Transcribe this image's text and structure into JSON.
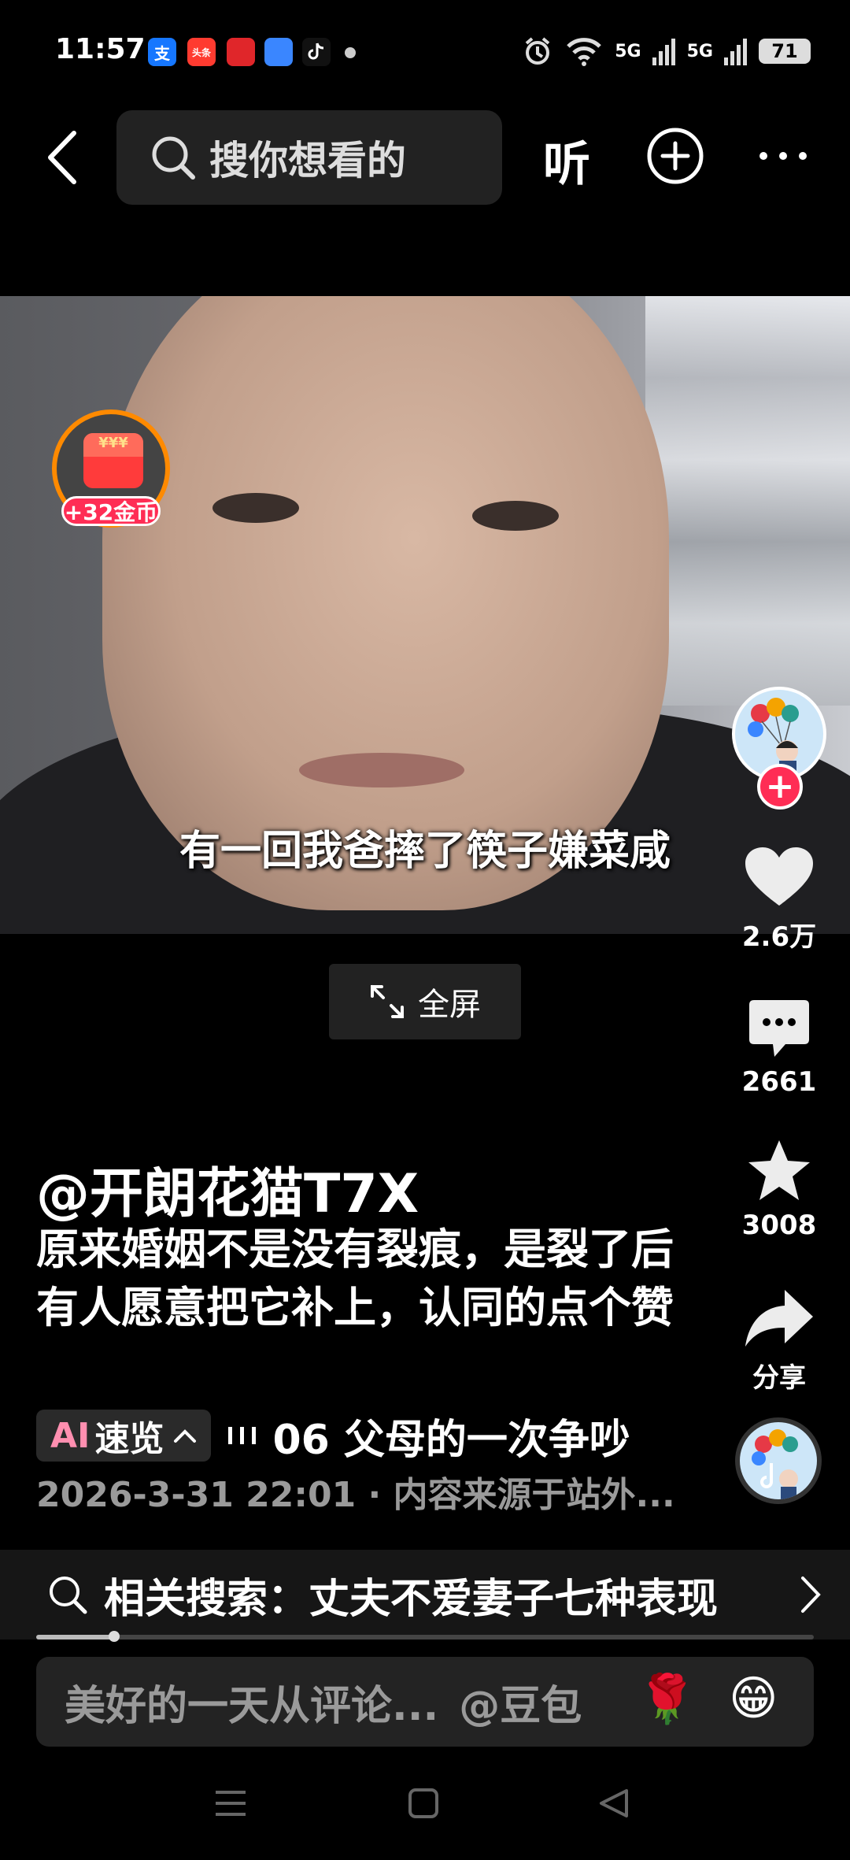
{
  "status_bar": {
    "time": "11:57",
    "apps": [
      {
        "label": "支",
        "bg": "#1677ff"
      },
      {
        "label": "头条",
        "bg": "#ff3b30"
      },
      {
        "label": "",
        "bg": "#e0262a"
      },
      {
        "label": "",
        "bg": "#3a86ff"
      },
      {
        "label": "",
        "bg": "#111111"
      }
    ],
    "signal_1": "5G",
    "signal_2": "5G",
    "battery": "71"
  },
  "header": {
    "search_placeholder": "搜你想看的",
    "listen_label": "听"
  },
  "video": {
    "subtitle": "有一回我爸摔了筷子嫌菜咸",
    "coin_badge_label": "+32金币",
    "fullscreen_label": "全屏"
  },
  "rail": {
    "like_count": "2.6万",
    "comment_count": "2661",
    "favorite_count": "3008",
    "share_label": "分享"
  },
  "post": {
    "author": "@开朗花猫T7X",
    "caption": "原来婚姻不是没有裂痕，是裂了后有人愿意把它补上，认同的点个赞",
    "ai_tag": "AI",
    "ai_label": "速览",
    "playlist_text": "06 父母的一次争吵",
    "meta": "2026-3-31 22:01 · 内容来源于站外..."
  },
  "related_search": {
    "label": "相关搜索：丈夫不爱妻子七种表现"
  },
  "progress": {
    "fraction": 0.1
  },
  "comment_bar": {
    "placeholder": "美好的一天从评论...",
    "mention": "@豆包",
    "emoji_1": "🌹",
    "emoji_2": "😁"
  },
  "colors": {
    "accent_red": "#ff2d55",
    "coin_ring": "#ff8a00"
  }
}
